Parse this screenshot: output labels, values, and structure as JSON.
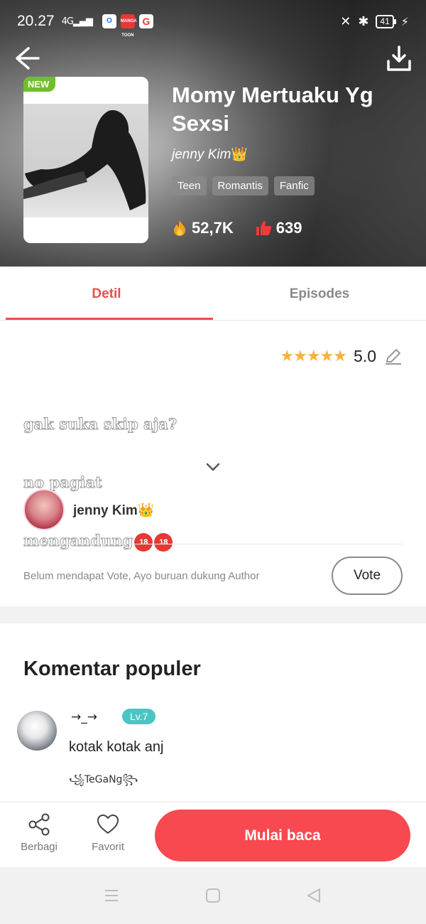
{
  "status_bar": {
    "time": "20.27",
    "signal": "4G",
    "notif_icons": [
      "O",
      "MANGA TOON",
      "G"
    ],
    "battery": "41"
  },
  "header": {
    "badge": "NEW",
    "title": "Momy Mertuaku Yg Sexsi",
    "author": "jenny Kim",
    "crown": "👑",
    "tags": [
      "Teen",
      "Romantis",
      "Fanfic"
    ],
    "views": "52,7K",
    "likes": "639"
  },
  "tabs": [
    {
      "label": "Detil",
      "active": true
    },
    {
      "label": "Episodes",
      "active": false
    }
  ],
  "detail": {
    "rating": "5.0",
    "stars": 5,
    "desc_lines": [
      "gak suka skip aja?",
      "no pagiat",
      "mengandung"
    ],
    "age_badges": [
      "18",
      "18"
    ],
    "author_name": "jenny Kim",
    "vote_text": "Belum mendapat Vote, Ayo buruan dukung Author",
    "vote_label": "Vote"
  },
  "comments": {
    "title": "Komentar populer",
    "items": [
      {
        "name": "→_→",
        "level": "Lv.7",
        "text": "kotak kotak anj",
        "signature": "꧁TeGaNg꧂"
      }
    ]
  },
  "bottom_bar": {
    "share_label": "Berbagi",
    "favorite_label": "Favorit",
    "read_label": "Mulai baca"
  },
  "colors": {
    "accent": "#f7494f",
    "tab_active": "#ee4d4d",
    "star": "#f7b23b",
    "level_badge": "#4cc4c4",
    "new_badge": "#6fbf2a"
  }
}
